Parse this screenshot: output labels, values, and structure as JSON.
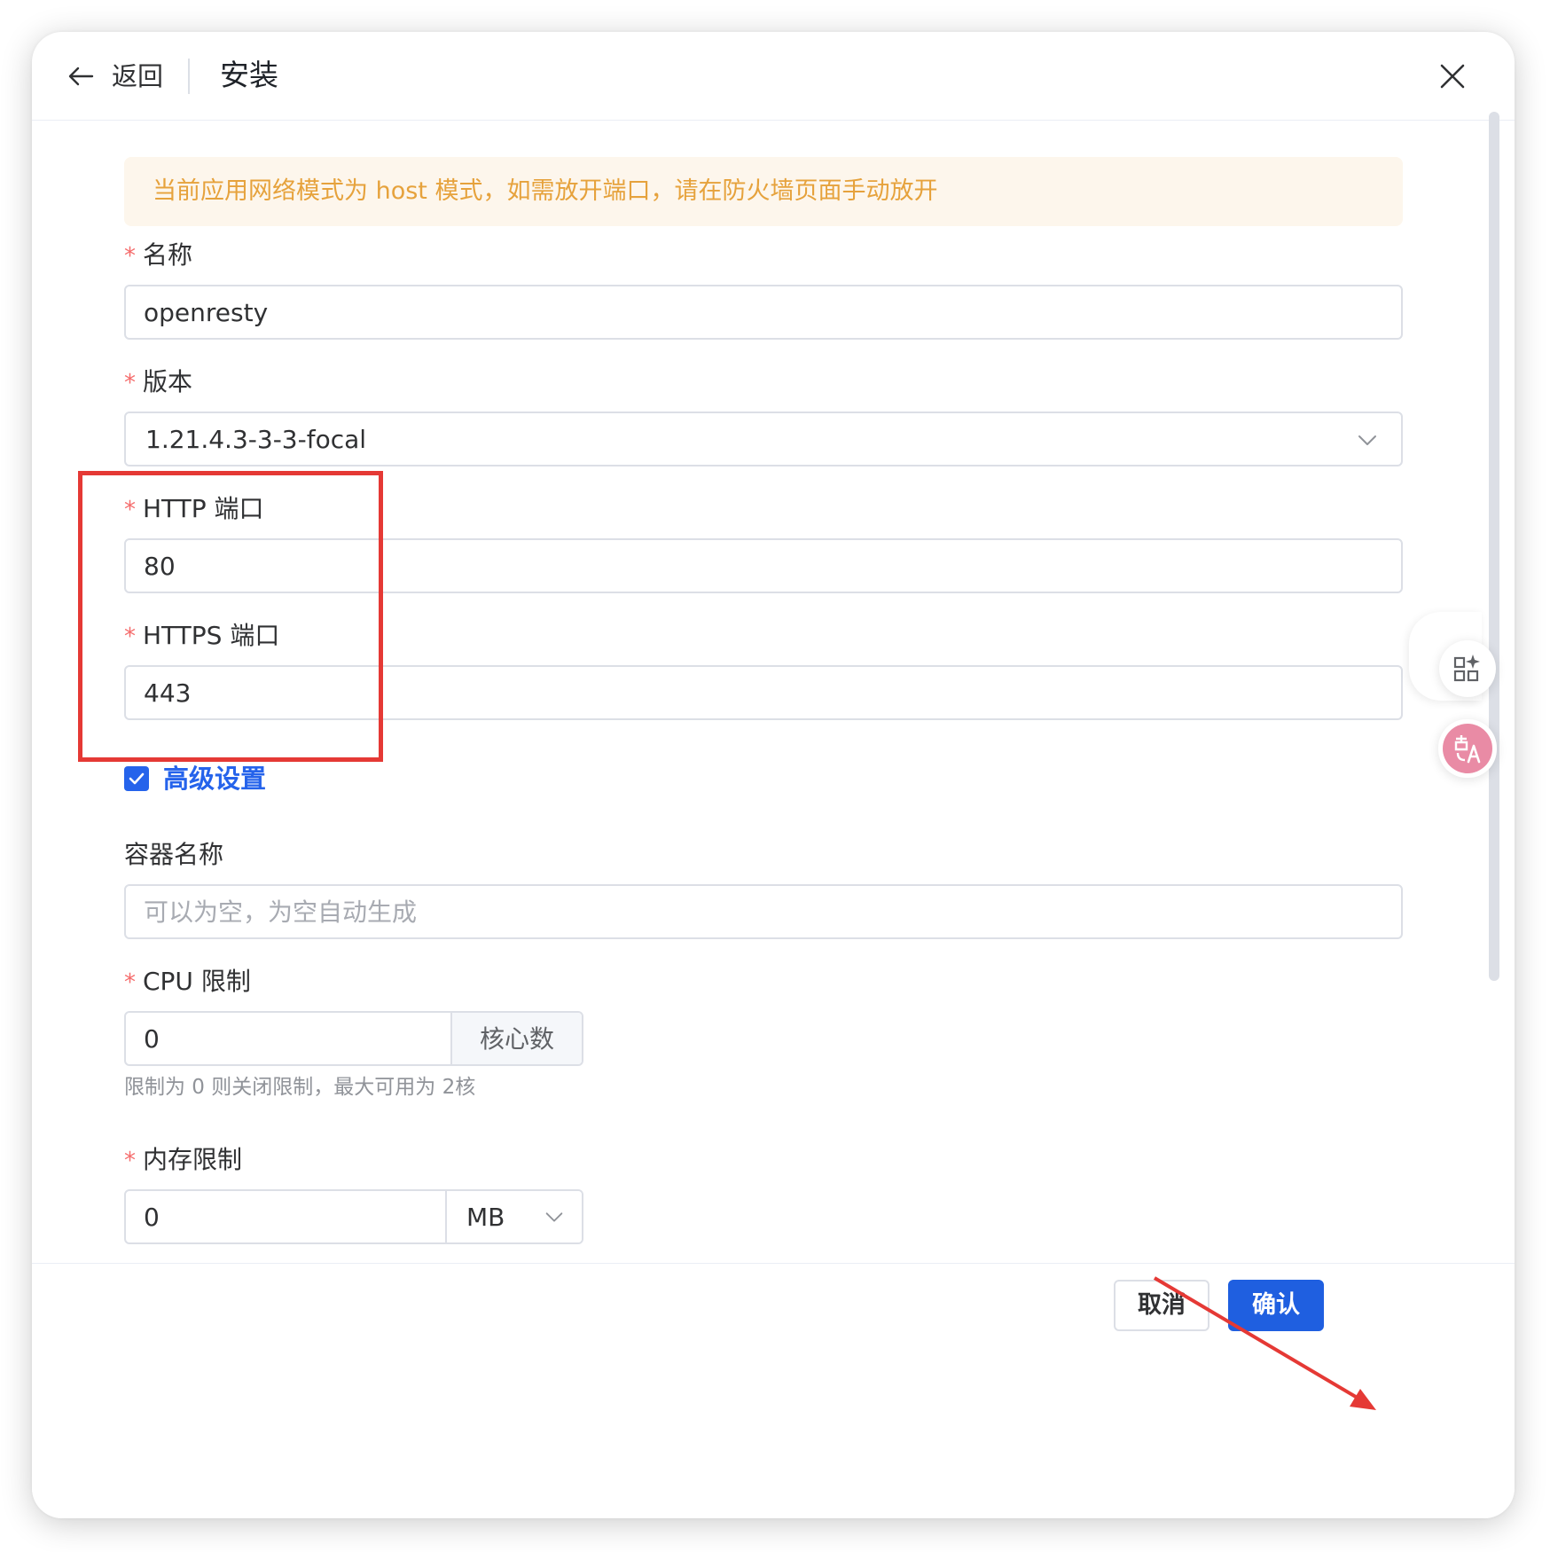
{
  "header": {
    "back_label": "返回",
    "title": "安装"
  },
  "alert": {
    "text": "当前应用网络模式为 host 模式，如需放开端口，请在防火墙页面手动放开"
  },
  "form": {
    "name": {
      "label": "名称",
      "required_mark": "*",
      "value": "openresty"
    },
    "version": {
      "label": "版本",
      "required_mark": "*",
      "value": "1.21.4.3-3-3-focal"
    },
    "http_port": {
      "label": "HTTP 端口",
      "required_mark": "*",
      "value": "80"
    },
    "https_port": {
      "label": "HTTPS 端口",
      "required_mark": "*",
      "value": "443"
    },
    "advanced": {
      "label": "高级设置",
      "checked": true
    },
    "container_name": {
      "label": "容器名称",
      "placeholder": "可以为空，为空自动生成"
    },
    "cpu_limit": {
      "label": "CPU 限制",
      "required_mark": "*",
      "value": "0",
      "unit": "核心数",
      "hint": "限制为 0 则关闭限制，最大可用为 2核"
    },
    "memory_limit": {
      "label": "内存限制",
      "required_mark": "*",
      "value": "0",
      "unit": "MB"
    }
  },
  "footer": {
    "cancel_label": "取消",
    "confirm_label": "确认"
  },
  "colors": {
    "primary": "#1f5fe0",
    "warning_text": "#e6a23c",
    "warning_bg": "#fdf6ec",
    "required": "#f56c6c",
    "annotation": "#e53935"
  },
  "icons": [
    "back-arrow-icon",
    "close-icon",
    "chevron-down-icon",
    "check-icon",
    "app-grid-sparkle-icon",
    "translate-icon"
  ]
}
